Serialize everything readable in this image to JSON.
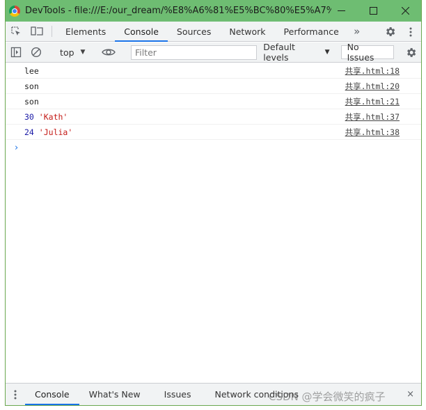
{
  "window": {
    "title": "DevTools - file:///E:/our_dream/%E8%A6%81%E5%BC%80%E5%A7%8B%...",
    "controls": [
      "minimize-icon",
      "maximize-icon",
      "close-icon"
    ]
  },
  "tabs": {
    "items": [
      {
        "label": "Elements"
      },
      {
        "label": "Console",
        "active": true
      },
      {
        "label": "Sources"
      },
      {
        "label": "Network"
      },
      {
        "label": "Performance"
      }
    ],
    "more": "»"
  },
  "toolbar": {
    "context": "top",
    "filter_placeholder": "Filter",
    "levels": "Default levels",
    "issues": "No Issues"
  },
  "log": [
    {
      "parts": [
        {
          "text": "lee",
          "kind": "plain"
        }
      ],
      "source": "共享.html:18"
    },
    {
      "parts": [
        {
          "text": "son",
          "kind": "plain"
        }
      ],
      "source": "共享.html:20"
    },
    {
      "parts": [
        {
          "text": "son",
          "kind": "plain"
        }
      ],
      "source": "共享.html:21"
    },
    {
      "parts": [
        {
          "text": "30",
          "kind": "num"
        },
        {
          "text": "'Kath'",
          "kind": "str"
        }
      ],
      "source": "共享.html:37"
    },
    {
      "parts": [
        {
          "text": "24",
          "kind": "num"
        },
        {
          "text": "'Julia'",
          "kind": "str"
        }
      ],
      "source": "共享.html:38"
    }
  ],
  "prompt": "›",
  "drawer": {
    "tabs": [
      {
        "label": "Console",
        "active": true
      },
      {
        "label": "What's New"
      },
      {
        "label": "Issues"
      },
      {
        "label": "Network conditions"
      }
    ],
    "close": "×"
  },
  "watermark": "CSDN @学会微笑的疯子",
  "colors": {
    "titlebar": "#6ebd72",
    "accent": "#1a73e8",
    "number": "#1a1aa6",
    "string": "#c41a16"
  }
}
